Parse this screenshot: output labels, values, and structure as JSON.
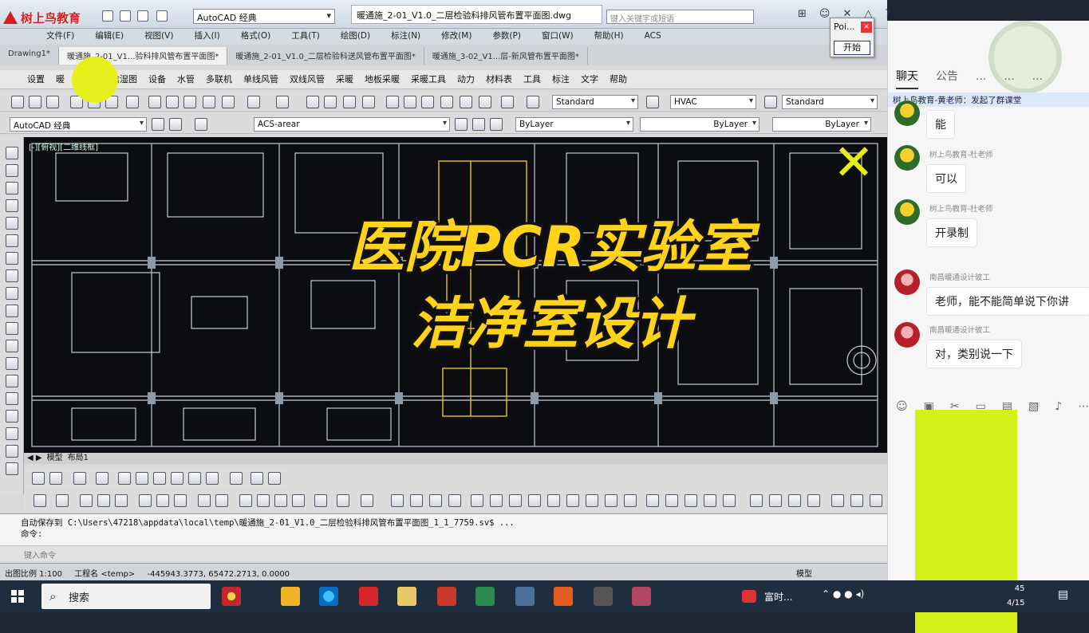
{
  "brand": {
    "name": "树上鸟教育"
  },
  "acad": {
    "workspace": "AutoCAD 经典",
    "doc_title": "暖通施_2-01_V1.0_二层检验科排风管布置平面图.dwg",
    "search_placeholder": "键入关键字或短语",
    "menu": [
      "文件(F)",
      "编辑(E)",
      "视图(V)",
      "插入(I)",
      "格式(O)",
      "工具(T)",
      "绘图(D)",
      "标注(N)",
      "修改(M)",
      "参数(P)",
      "窗口(W)",
      "帮助(H)",
      "ACS"
    ],
    "tabs": [
      "Drawing1*",
      "暖通施_2-01_V1...验科排风管布置平面图*",
      "暖通施_2-01_V1.0_二层检验科送风管布置平面图*",
      "暖通施_3-02_V1...层-新风管布置平面图*"
    ],
    "hvac_menu": [
      "设置",
      "暖",
      "",
      "焓湿图",
      "设备",
      "水管",
      "多联机",
      "单线风管",
      "双线风管",
      "采暖",
      "地板采暖",
      "采暖工具",
      "动力",
      "材料表",
      "工具",
      "标注",
      "文字",
      "帮助"
    ],
    "text_style": "Standard",
    "dim_style": "HVAC",
    "table_style": "Standard",
    "workspace2": "AutoCAD 经典",
    "layer": "ACS-arear",
    "color": "ByLayer",
    "linetype": "ByLayer",
    "lineweight": "ByLayer",
    "view_label": "[-][俯视][二维线框]",
    "layout_tabs": [
      "模型",
      "布局1"
    ],
    "command_history": "自动保存到 C:\\Users\\47218\\appdata\\local\\temp\\暖通施_2-01_V1.0_二层检验科排风管布置平面图_1_1_7759.sv$ ...",
    "command_prompt": "命令:",
    "command_input_placeholder": "键入命令",
    "status_scale": "出图比例 1:100",
    "status_project": "工程名 <temp>",
    "status_coords": "-445943.3773, 65472.2713, 0.0000",
    "status_model": "模型"
  },
  "overlay": {
    "line1": "医院PCR实验室",
    "line2": "洁净室设计"
  },
  "point_dialog": {
    "title": "Poi...",
    "button": "开始"
  },
  "chat": {
    "tabs": [
      "聊天",
      "公告",
      "...",
      "...",
      "..."
    ],
    "notice": "树上鸟教育-黄老师：发起了群课堂",
    "messages": [
      {
        "sender": "",
        "text": "能",
        "avatar": "green"
      },
      {
        "sender": "树上鸟教育-杜老师",
        "text": "可以",
        "avatar": "green"
      },
      {
        "sender": "树上鸟教育-杜老师",
        "text": "开录制",
        "avatar": "green"
      },
      {
        "sender": "南昌暖通设计彼工",
        "text": "老师，能不能简单说下你讲",
        "avatar": "red"
      },
      {
        "sender": "南昌暖通设计彼工",
        "text": "对，类别说一下",
        "avatar": "red"
      }
    ]
  },
  "taskbar": {
    "search": "搜索",
    "tray_text": "富时...",
    "time": "45",
    "date": "4/15"
  },
  "colors": {
    "accent_yellow": "#ffd21c",
    "highlight": "#e7ef1c",
    "brand_red": "#d61f1f"
  }
}
